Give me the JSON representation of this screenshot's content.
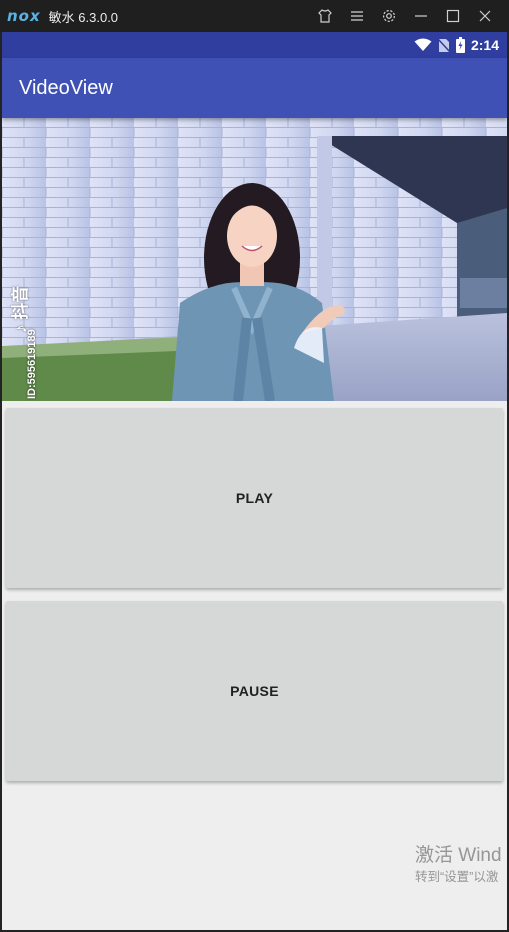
{
  "emulator": {
    "logo": "nox",
    "title": "敏水 6.3.0.0",
    "icons": [
      "shirt-icon",
      "menu-icon",
      "gear-icon",
      "minimize-icon",
      "maximize-icon",
      "close-icon"
    ]
  },
  "statusbar": {
    "time": "2:14",
    "icons": [
      "wifi-icon",
      "no-sim-icon",
      "battery-icon"
    ]
  },
  "appbar": {
    "title": "VideoView"
  },
  "video": {
    "watermark_logo": "♪ 抖音",
    "watermark_id": "ID:595619189"
  },
  "buttons": {
    "play_label": "PLAY",
    "pause_label": "PAUSE"
  },
  "activation": {
    "title": "激活 Wind",
    "subtitle": "转到“设置”以激"
  },
  "colors": {
    "statusbar": "#303f9f",
    "appbar": "#3f51b5",
    "button_bg": "#d6d7d7",
    "background": "#eeeeee"
  }
}
